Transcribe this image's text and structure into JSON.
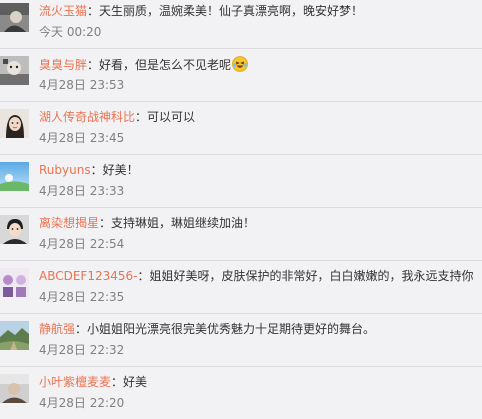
{
  "colors": {
    "username": "#eb7350",
    "text": "#333333",
    "time": "#808080",
    "background": "#f2f2f5",
    "divider": "#dcdce0"
  },
  "comments": [
    {
      "user": "流火玉猫",
      "separator": "：",
      "text": "天生丽质，温婉柔美！仙子真漂亮啊，晚安好梦！",
      "time": "今天 00:20",
      "avatar_icon": "user-avatar-icon"
    },
    {
      "user": "臭臭与胖",
      "separator": "：",
      "text": "好看，但是怎么不见老呢",
      "time": "4月28日 23:53",
      "avatar_icon": "user-avatar-icon",
      "emoji_icon": "laughing-tears-emoji-icon"
    },
    {
      "user": "湖人传奇战神科比",
      "separator": "：",
      "text": "可以可以",
      "time": "4月28日 23:45",
      "avatar_icon": "user-avatar-icon"
    },
    {
      "user": "Rubyuns",
      "separator": "：",
      "text": "好美！",
      "time": "4月28日 23:33",
      "avatar_icon": "user-avatar-icon"
    },
    {
      "user": "离染想揭星",
      "separator": "：",
      "text": "支持琳姐，琳姐继续加油！",
      "time": "4月28日 22:54",
      "avatar_icon": "user-avatar-icon"
    },
    {
      "user": "ABCDEF123456-",
      "separator": "：",
      "text": "姐姐好美呀，皮肤保护的非常好，白白嫩嫩的，我永远支持你",
      "time": "4月28日 22:35",
      "avatar_icon": "user-avatar-icon"
    },
    {
      "user": "静航强",
      "separator": "：",
      "text": "小姐姐阳光漂亮很完美优秀魅力十足期待更好的舞台。",
      "time": "4月28日 22:32",
      "avatar_icon": "user-avatar-icon"
    },
    {
      "user": "小叶紫檀麦麦",
      "separator": "：",
      "text": "好美",
      "time": "4月28日 22:20",
      "avatar_icon": "user-avatar-icon"
    }
  ]
}
